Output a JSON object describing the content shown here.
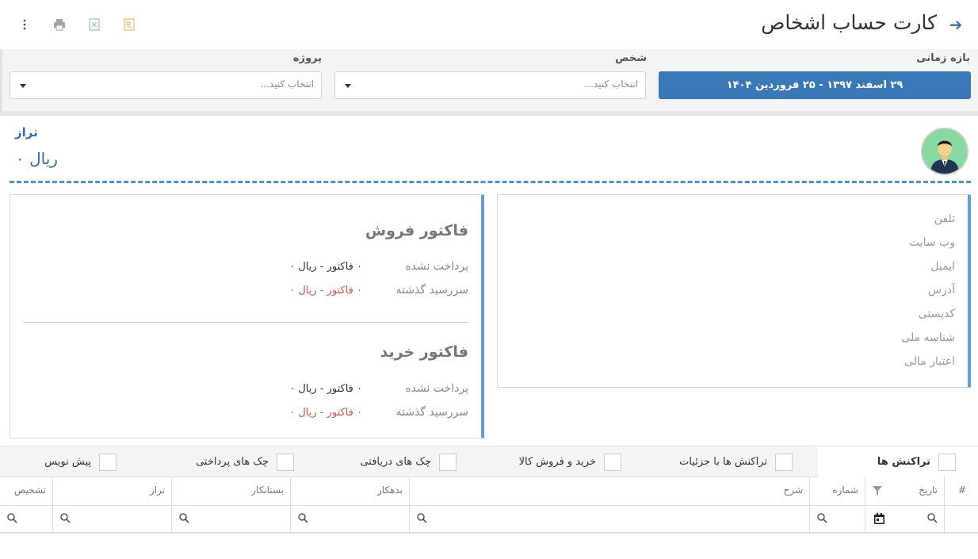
{
  "header": {
    "title": "کارت حساب اشخاص",
    "back_icon": "arrow-right-icon",
    "toolbar_icons": [
      "more-vertical-icon",
      "print-icon",
      "excel-export-icon",
      "pdf-export-icon"
    ]
  },
  "filters": {
    "date_range": {
      "label": "بازه زمانی",
      "value": "۲۹ اسفند ۱۳۹۷ - ۲۵ فروردین ۱۴۰۴"
    },
    "person": {
      "label": "شخص",
      "placeholder": "انتخاب کنید..."
    },
    "project": {
      "label": "پروژه",
      "placeholder": "انتخاب کنید..."
    }
  },
  "balance": {
    "label": "تراز",
    "value": "ریال ۰"
  },
  "info": {
    "fields": [
      "تلفن",
      "وب سایت",
      "ایمیل",
      "آدرس",
      "کدپستی",
      "شناسه ملی",
      "اعتبار مالی"
    ]
  },
  "sales_invoice": {
    "title": "فاکتور فروش",
    "unpaid_label": "پرداخت نشده",
    "unpaid_value": "۰ فاکتور - ریال ۰",
    "overdue_label": "سررسید گذشته",
    "overdue_value": "۰ فاکتور - ریال ۰"
  },
  "purchase_invoice": {
    "title": "فاکتور خرید",
    "unpaid_label": "پرداخت نشده",
    "unpaid_value": "۰ فاکتور - ریال ۰",
    "overdue_label": "سررسید گذشته",
    "overdue_value": "۰ فاکتور - ریال ۰"
  },
  "tabs": [
    {
      "label": "تراکنش ها",
      "active": true
    },
    {
      "label": "تراکنش ها با جزئیات",
      "active": false
    },
    {
      "label": "خرید و فروش کالا",
      "active": false
    },
    {
      "label": "چک های دریافتی",
      "active": false
    },
    {
      "label": "چک های پرداختی",
      "active": false
    },
    {
      "label": "پیش نویس",
      "active": false
    }
  ],
  "grid": {
    "columns": [
      "#",
      "تاریخ",
      "شماره",
      "شرح",
      "بدهکار",
      "بستانکار",
      "تراز",
      "تشخیص"
    ]
  },
  "colors": {
    "accent": "#3a78b8",
    "card_border": "#5aa1e6",
    "danger": "#e0524a"
  }
}
